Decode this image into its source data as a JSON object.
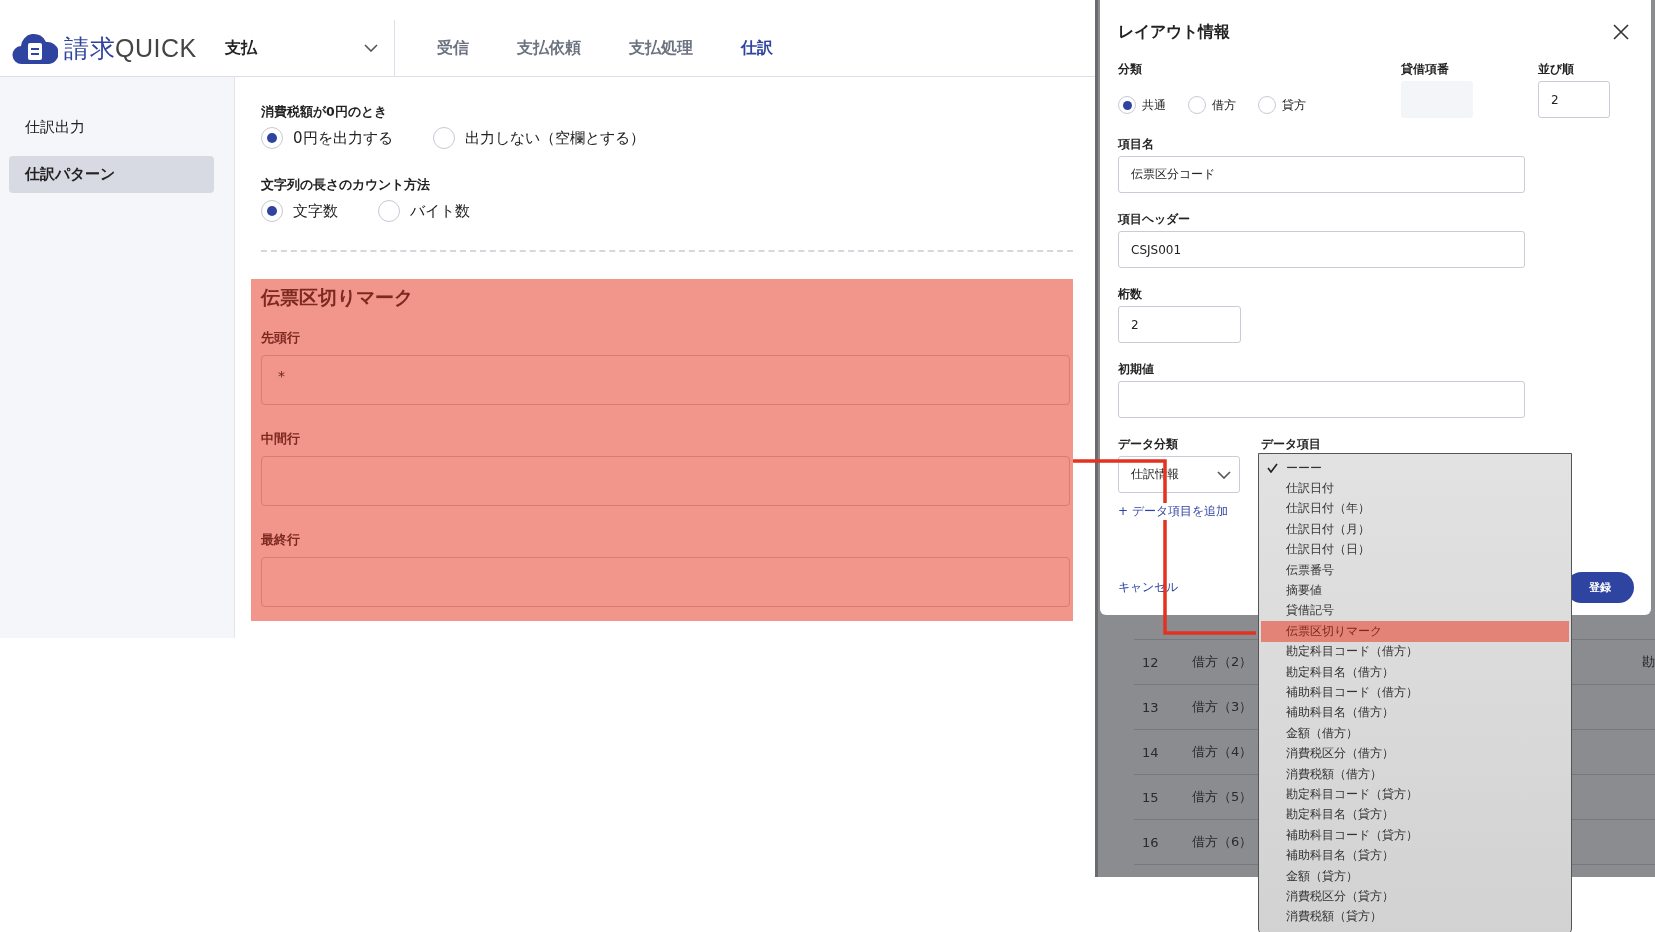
{
  "app": {
    "logo": {
      "kanji": "請求",
      "latin": "QUICK"
    },
    "module_select": "支払",
    "tabs": [
      {
        "label": "受信",
        "selected": false
      },
      {
        "label": "支払依頼",
        "selected": false
      },
      {
        "label": "支払処理",
        "selected": false
      },
      {
        "label": "仕訳",
        "selected": true
      }
    ]
  },
  "sidebar": {
    "items": [
      {
        "label": "仕訳出力",
        "selected": false
      },
      {
        "label": "仕訳パターン",
        "selected": true
      }
    ]
  },
  "settings": [
    {
      "label": "消費税額が0円のとき",
      "options": [
        {
          "label": "0円を出力する",
          "selected": true
        },
        {
          "label": "出力しない（空欄とする）",
          "selected": false
        }
      ]
    },
    {
      "label": "文字列の長さのカウント方法",
      "options": [
        {
          "label": "文字数",
          "selected": true
        },
        {
          "label": "バイト数",
          "selected": false
        }
      ]
    }
  ],
  "highlight_section": {
    "title": "伝票区切りマーク",
    "fields": [
      {
        "label": "先頭行",
        "value": "*"
      },
      {
        "label": "中間行"
      },
      {
        "label": "最終行"
      }
    ]
  },
  "background_table": {
    "rows": [
      {
        "number": "12",
        "side": "借方（2）",
        "column_3": "勘"
      },
      {
        "number": "13",
        "side": "借方（3）"
      },
      {
        "number": "14",
        "side": "借方（4）"
      },
      {
        "number": "15",
        "side": "借方（5）"
      },
      {
        "number": "16",
        "side": "借方（6）"
      }
    ]
  },
  "dialog": {
    "title": "レイアウト情報",
    "category": {
      "label": "分類",
      "options": [
        {
          "label": "共通",
          "selected": true
        },
        {
          "label": "借方",
          "selected": false
        },
        {
          "label": "貸方",
          "selected": false
        }
      ]
    },
    "debit_credit_number": {
      "label": "貸借項番",
      "disabled": true
    },
    "sort_order": {
      "label": "並び順",
      "value": "2"
    },
    "item_name": {
      "label": "項目名",
      "value": "伝票区分コード"
    },
    "item_header": {
      "label": "項目ヘッダー",
      "value": "CSJS001"
    },
    "digits": {
      "label": "桁数",
      "value": "2"
    },
    "initial_value": {
      "label": "初期値"
    },
    "data_category": {
      "label": "データ分類",
      "value": "仕訳情報"
    },
    "data_item": {
      "label": "データ項目"
    },
    "add_link": "+ データ項目を追加",
    "cancel": "キャンセル",
    "submit": "登録"
  },
  "dropdown": {
    "items": [
      {
        "label": "ーーー",
        "checked": true,
        "selected": false
      },
      {
        "label": "仕訳日付",
        "checked": false,
        "selected": false
      },
      {
        "label": "仕訳日付（年）",
        "checked": false,
        "selected": false
      },
      {
        "label": "仕訳日付（月）",
        "checked": false,
        "selected": false
      },
      {
        "label": "仕訳日付（日）",
        "checked": false,
        "selected": false
      },
      {
        "label": "伝票番号",
        "checked": false,
        "selected": false
      },
      {
        "label": "摘要値",
        "checked": false,
        "selected": false
      },
      {
        "label": "貸借記号",
        "checked": false,
        "selected": false
      },
      {
        "label": "伝票区切りマーク",
        "checked": false,
        "selected": true
      },
      {
        "label": "勘定科目コード（借方）",
        "checked": false,
        "selected": false
      },
      {
        "label": "勘定科目名（借方）",
        "checked": false,
        "selected": false
      },
      {
        "label": "補助科目コード（借方）",
        "checked": false,
        "selected": false
      },
      {
        "label": "補助科目名（借方）",
        "checked": false,
        "selected": false
      },
      {
        "label": "金額（借方）",
        "checked": false,
        "selected": false
      },
      {
        "label": "消費税区分（借方）",
        "checked": false,
        "selected": false
      },
      {
        "label": "消費税額（借方）",
        "checked": false,
        "selected": false
      },
      {
        "label": "勘定科目コード（貸方）",
        "checked": false,
        "selected": false
      },
      {
        "label": "勘定科目名（貸方）",
        "checked": false,
        "selected": false
      },
      {
        "label": "補助科目コード（貸方）",
        "checked": false,
        "selected": false
      },
      {
        "label": "補助科目名（貸方）",
        "checked": false,
        "selected": false
      },
      {
        "label": "金額（貸方）",
        "checked": false,
        "selected": false
      },
      {
        "label": "消費税区分（貸方）",
        "checked": false,
        "selected": false
      },
      {
        "label": "消費税額（貸方）",
        "checked": false,
        "selected": false
      }
    ]
  }
}
